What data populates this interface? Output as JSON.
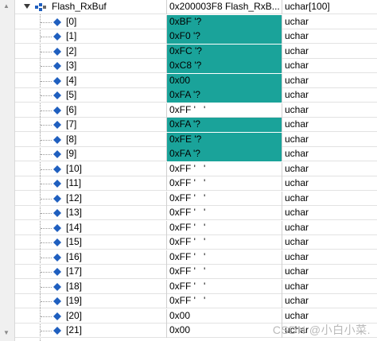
{
  "variable": {
    "name": "Flash_RxBuf",
    "value": "0x200003F8 Flash_RxB...",
    "type": "uchar[100]"
  },
  "elements": [
    {
      "index": "[0]",
      "value": "0xBF '?",
      "type": "uchar",
      "changed": true
    },
    {
      "index": "[1]",
      "value": "0xF0 '?",
      "type": "uchar",
      "changed": true
    },
    {
      "index": "[2]",
      "value": "0xFC '?",
      "type": "uchar",
      "changed": true
    },
    {
      "index": "[3]",
      "value": "0xC8 '?",
      "type": "uchar",
      "changed": true
    },
    {
      "index": "[4]",
      "value": "0x00",
      "type": "uchar",
      "changed": true
    },
    {
      "index": "[5]",
      "value": "0xFA '?",
      "type": "uchar",
      "changed": true
    },
    {
      "index": "[6]",
      "value": "0xFF '   '",
      "type": "uchar",
      "changed": false
    },
    {
      "index": "[7]",
      "value": "0xFA '?",
      "type": "uchar",
      "changed": true
    },
    {
      "index": "[8]",
      "value": "0xFE '?",
      "type": "uchar",
      "changed": true
    },
    {
      "index": "[9]",
      "value": "0xFA '?",
      "type": "uchar",
      "changed": true
    },
    {
      "index": "[10]",
      "value": "0xFF '   '",
      "type": "uchar",
      "changed": false
    },
    {
      "index": "[11]",
      "value": "0xFF '   '",
      "type": "uchar",
      "changed": false
    },
    {
      "index": "[12]",
      "value": "0xFF '   '",
      "type": "uchar",
      "changed": false
    },
    {
      "index": "[13]",
      "value": "0xFF '   '",
      "type": "uchar",
      "changed": false
    },
    {
      "index": "[14]",
      "value": "0xFF '   '",
      "type": "uchar",
      "changed": false
    },
    {
      "index": "[15]",
      "value": "0xFF '   '",
      "type": "uchar",
      "changed": false
    },
    {
      "index": "[16]",
      "value": "0xFF '   '",
      "type": "uchar",
      "changed": false
    },
    {
      "index": "[17]",
      "value": "0xFF '   '",
      "type": "uchar",
      "changed": false
    },
    {
      "index": "[18]",
      "value": "0xFF '   '",
      "type": "uchar",
      "changed": false
    },
    {
      "index": "[19]",
      "value": "0xFF '   '",
      "type": "uchar",
      "changed": false
    },
    {
      "index": "[20]",
      "value": "0x00",
      "type": "uchar",
      "changed": false
    },
    {
      "index": "[21]",
      "value": "0x00",
      "type": "uchar",
      "changed": false
    }
  ],
  "colors": {
    "changed_value_bg": "#1aa39a",
    "element_icon": "#1f5fbf"
  },
  "watermark": "CSDN @小白小菜."
}
